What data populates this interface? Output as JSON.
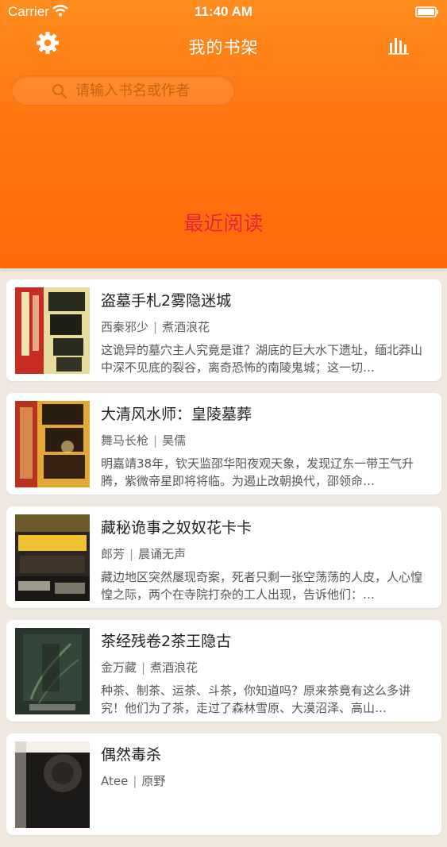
{
  "status_bar": {
    "carrier": "Carrier",
    "time": "11:40 AM"
  },
  "nav": {
    "title": "我的书架",
    "left_icon": "gear-icon",
    "right_icon": "bar-chart-icon"
  },
  "search": {
    "placeholder": "请输入书名或作者",
    "value": ""
  },
  "section": {
    "title": "最近阅读"
  },
  "colors": {
    "header_top": "#ff8c1e",
    "header_bottom": "#ff6a08",
    "section_title": "#e8232a",
    "background": "#efe8df"
  },
  "books": [
    {
      "title": "盗墓手札2雾隐迷城",
      "author": "西秦邪少",
      "narrator": "煮酒浪花",
      "desc": "这诡异的墓穴主人究竟是谁？湖底的巨大水下遗址，缅北莽山中深不见底的裂谷，离奇恐怖的南陵鬼城；这一切…"
    },
    {
      "title": "大清风水师：皇陵墓葬",
      "author": "舞马长枪",
      "narrator": "昊儒",
      "desc": "明嘉靖38年，钦天监邵华阳夜观天象，发现辽东一带王气升腾，紫微帝星即将将临。为遏止改朝换代，邵领命…"
    },
    {
      "title": "藏秘诡事之奴奴花卡卡",
      "author": "郎芳",
      "narrator": "晨诵无声",
      "desc": "藏边地区突然屡现奇案，死者只剩一张空荡荡的人皮，人心惶惶之际，两个在寺院打杂的工人出现，告诉他们：…"
    },
    {
      "title": "茶经残卷2茶王隐古",
      "author": "金万藏",
      "narrator": "煮酒浪花",
      "desc": "种茶、制茶、运茶、斗茶，你知道吗？原来茶竟有这么多讲究！他们为了茶，走过了森林雪原、大漠沼泽、高山…"
    },
    {
      "title": "偶然毒杀",
      "author": "Atee",
      "narrator": "原野",
      "desc": ""
    }
  ]
}
